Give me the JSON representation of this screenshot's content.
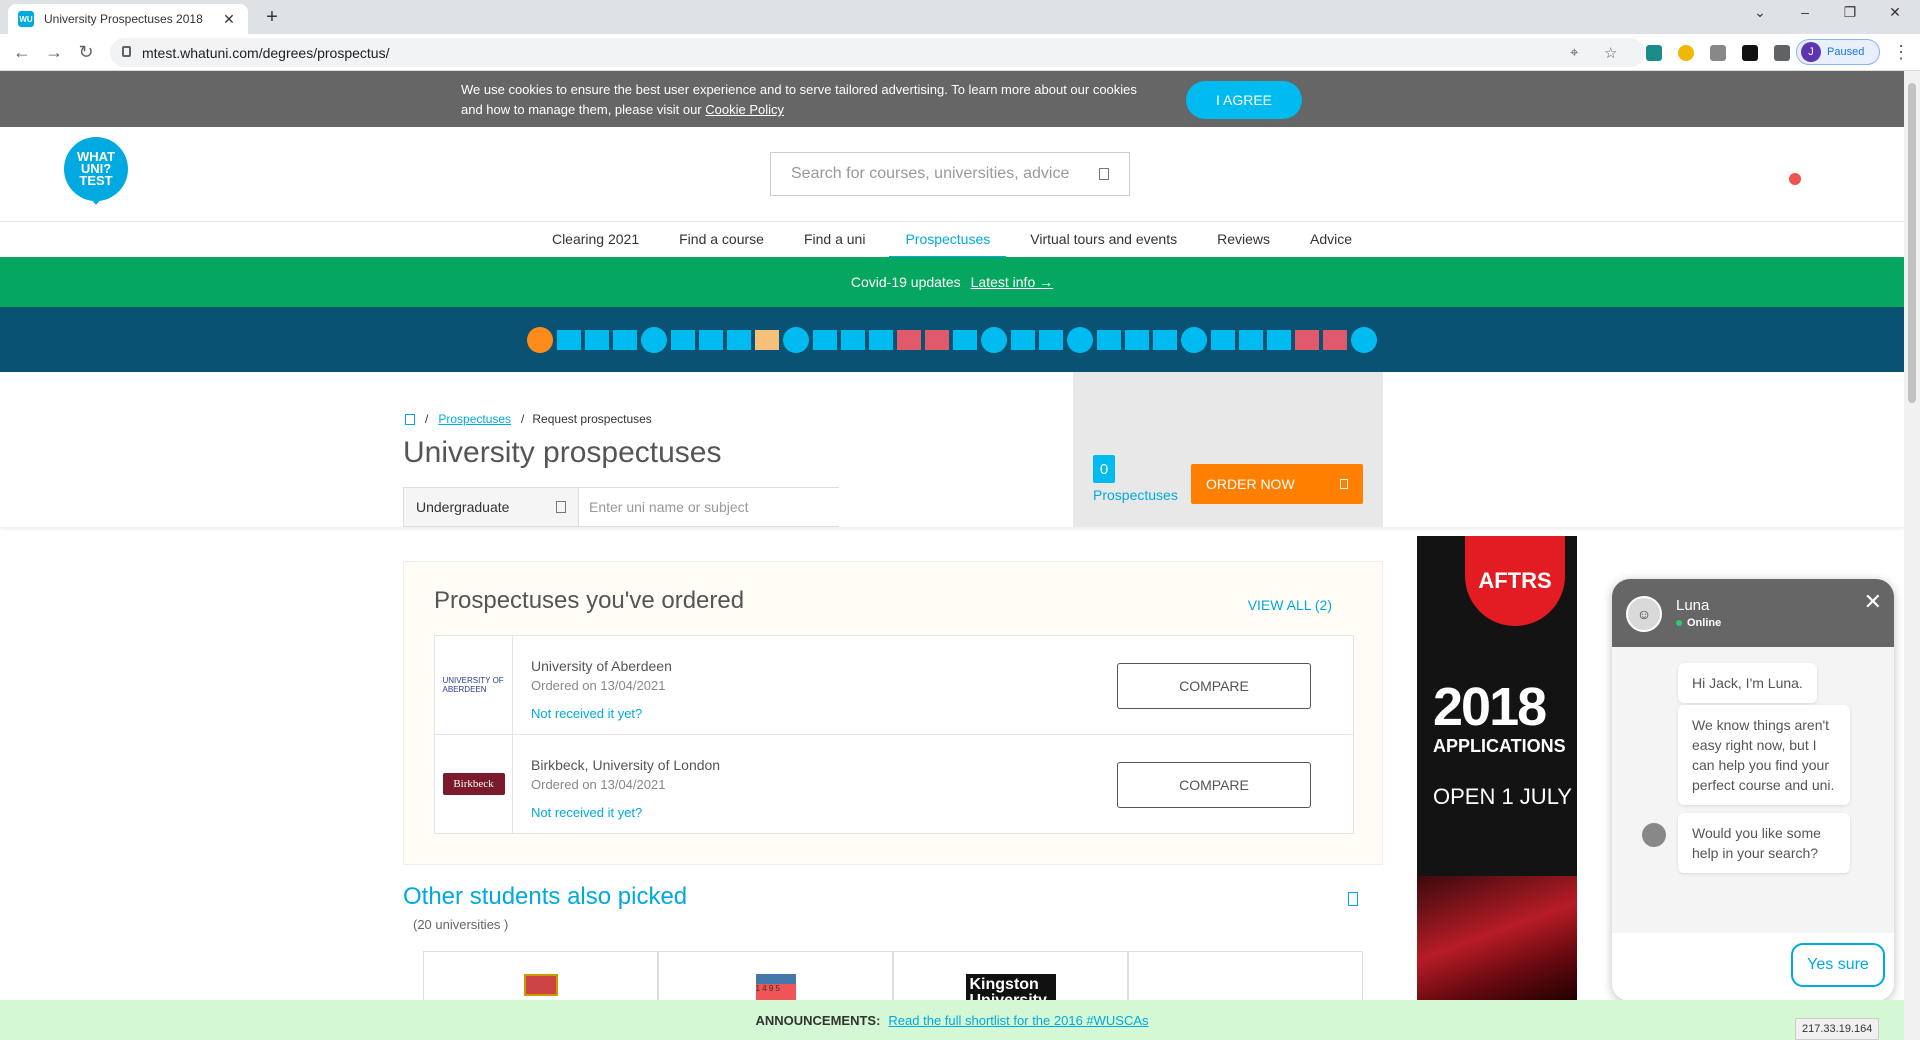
{
  "browser": {
    "tab_title": "University Prospectuses 2018",
    "favicon_text": "WU",
    "url": "mtest.whatuni.com/degrees/prospectus/",
    "profile_initial": "J",
    "profile_status": "Paused",
    "ip_tooltip": "217.33.19.164"
  },
  "cookie": {
    "text_prefix": "We use cookies to ensure the best user experience and to serve tailored advertising. To learn more about our cookies and how to manage them, please visit our ",
    "link": "Cookie Policy",
    "agree": "I AGREE"
  },
  "header": {
    "logo_text": "WHAT UNI? TEST",
    "search_placeholder": "Search for courses, universities, advice"
  },
  "nav": {
    "items": [
      "Clearing 2021",
      "Find a course",
      "Find a uni",
      "Prospectuses",
      "Virtual tours and events",
      "Reviews",
      "Advice"
    ],
    "active": "Prospectuses"
  },
  "covid": {
    "text": "Covid-19 updates",
    "link": "Latest info →"
  },
  "dotbar": {
    "colors": {
      "orange": "#ff8c1a",
      "blue": "#00bbf0",
      "tan": "#f5c07a",
      "red": "#e05a6b"
    },
    "pattern": [
      "orange-c",
      "blue-s",
      "blue-s",
      "blue-s",
      "blue-c",
      "blue-s",
      "blue-s",
      "blue-s",
      "tan-s",
      "blue-c",
      "blue-s",
      "blue-s",
      "blue-s",
      "red-s",
      "red-s",
      "blue-s",
      "blue-c",
      "blue-s",
      "blue-s",
      "blue-c",
      "blue-s",
      "blue-s",
      "blue-s",
      "blue-c",
      "blue-s",
      "blue-s",
      "blue-s",
      "red-s",
      "red-s",
      "blue-c"
    ]
  },
  "breadcrumb": {
    "link": "Prospectuses",
    "current": "Request prospectuses"
  },
  "page_title": "University prospectuses",
  "filter": {
    "level": "Undergraduate",
    "search_placeholder": "Enter uni name or subject"
  },
  "order": {
    "count": "0",
    "count_label": "Prospectuses",
    "button": "ORDER NOW"
  },
  "ordered": {
    "title": "Prospectuses you've ordered",
    "view_all": "VIEW ALL (2)",
    "rows": [
      {
        "name": "University of Aberdeen",
        "date": "Ordered on 13/04/2021",
        "link": "Not received it yet?",
        "logo": "UNIVERSITY OF ABERDEEN",
        "compare": "COMPARE"
      },
      {
        "name": "Birkbeck, University of London",
        "date": "Ordered on 13/04/2021",
        "link": "Not received it yet?",
        "logo": "Birkbeck",
        "compare": "COMPARE"
      }
    ]
  },
  "other": {
    "title": "Other students also picked",
    "count": "(20 universities )",
    "card2_text": "1 4 9 5",
    "card3_text": "Kingston University"
  },
  "ad": {
    "logo": "AFTRS",
    "year": "2018",
    "apps": "APPLICATIONS",
    "open": "OPEN 1 JULY"
  },
  "chat": {
    "name": "Luna",
    "status": "Online",
    "messages": [
      "Hi Jack, I'm Luna.",
      "We know things aren't easy right now, but I can help you find your perfect course and uni.",
      "Would you like some help in your search?"
    ],
    "reply": "Yes sure"
  },
  "announce": {
    "label": "ANNOUNCEMENTS:",
    "text": "Read the full shortlist for the 2016 #WUSCAs"
  }
}
